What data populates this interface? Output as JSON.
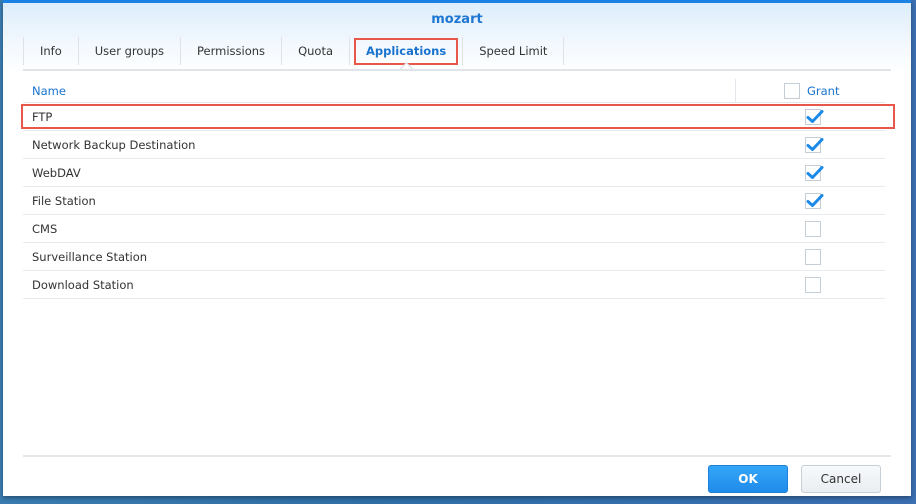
{
  "dialog": {
    "title": "mozart"
  },
  "tabs": [
    {
      "label": "Info",
      "active": false
    },
    {
      "label": "User groups",
      "active": false
    },
    {
      "label": "Permissions",
      "active": false
    },
    {
      "label": "Quota",
      "active": false
    },
    {
      "label": "Applications",
      "active": true
    },
    {
      "label": "Speed Limit",
      "active": false
    }
  ],
  "grid": {
    "columns": {
      "name": "Name",
      "grant": "Grant"
    },
    "grant_all_checked": false,
    "rows": [
      {
        "name": "FTP",
        "granted": true,
        "highlighted": true
      },
      {
        "name": "Network Backup Destination",
        "granted": true,
        "highlighted": false
      },
      {
        "name": "WebDAV",
        "granted": true,
        "highlighted": false
      },
      {
        "name": "File Station",
        "granted": true,
        "highlighted": false
      },
      {
        "name": "CMS",
        "granted": false,
        "highlighted": false
      },
      {
        "name": "Surveillance Station",
        "granted": false,
        "highlighted": false
      },
      {
        "name": "Download Station",
        "granted": false,
        "highlighted": false
      }
    ]
  },
  "footer": {
    "ok_label": "OK",
    "cancel_label": "Cancel"
  },
  "colors": {
    "accent": "#1a72cf",
    "highlight": "#e8584a",
    "check": "#1a8ae8"
  }
}
